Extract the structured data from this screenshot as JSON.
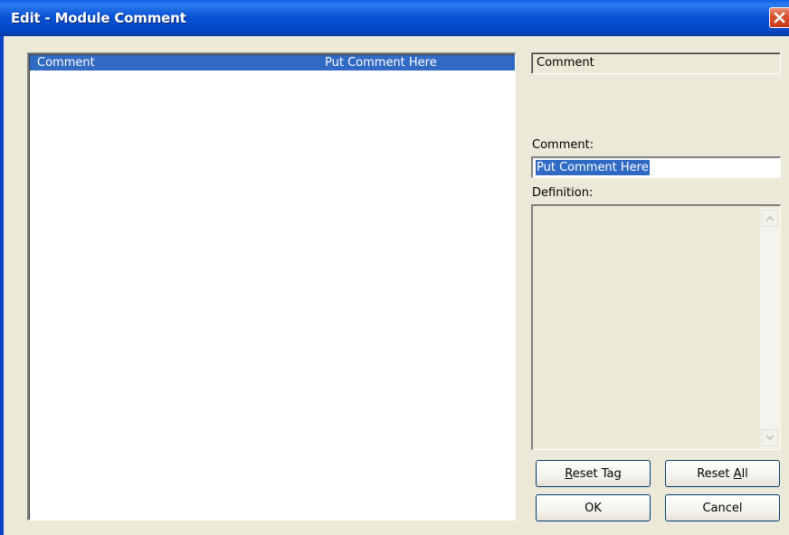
{
  "window": {
    "title": "Edit - Module Comment"
  },
  "list": {
    "rows": [
      {
        "name": "Comment",
        "value": "Put Comment Here",
        "selected": true
      }
    ]
  },
  "detail": {
    "name_display": "Comment",
    "comment_label": "Comment:",
    "comment_value": "Put Comment Here",
    "definition_label": "Definition:",
    "definition_value": ""
  },
  "buttons": {
    "reset_tag": {
      "label": "Reset Tag",
      "accel": "R"
    },
    "reset_all": {
      "label": "Reset All",
      "accel": "A"
    },
    "ok": {
      "label": "OK"
    },
    "cancel": {
      "label": "Cancel"
    }
  },
  "colors": {
    "selection": "#316ac5",
    "dialog_bg": "#ece9d8",
    "title_bar": "#0853d6",
    "close_button": "#d9512e"
  },
  "icons": {
    "close": "close-icon",
    "scroll_up": "scroll-up-arrow-icon",
    "scroll_down": "scroll-down-arrow-icon"
  }
}
